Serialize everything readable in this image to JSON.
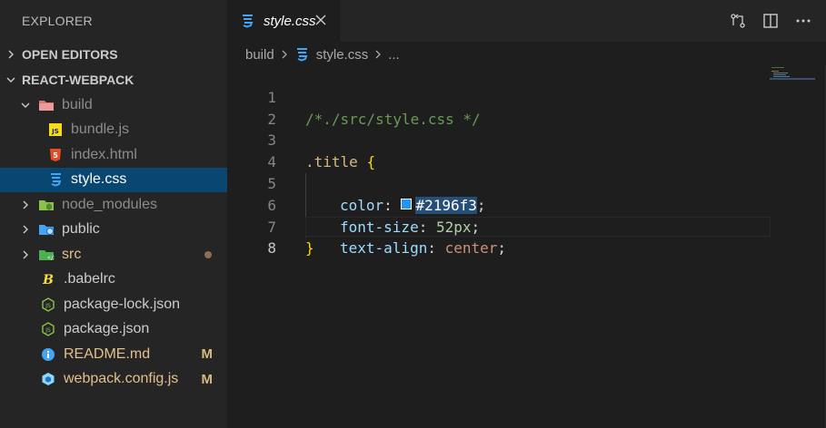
{
  "explorer": {
    "title": "EXPLORER",
    "open_editors": "OPEN EDITORS",
    "project": "REACT-WEBPACK",
    "items": [
      {
        "label": "build",
        "status": ""
      },
      {
        "label": "bundle.js",
        "status": ""
      },
      {
        "label": "index.html",
        "status": ""
      },
      {
        "label": "style.css",
        "status": ""
      },
      {
        "label": "node_modules",
        "status": ""
      },
      {
        "label": "public",
        "status": ""
      },
      {
        "label": "src",
        "status": ""
      },
      {
        "label": ".babelrc",
        "status": ""
      },
      {
        "label": "package-lock.json",
        "status": ""
      },
      {
        "label": "package.json",
        "status": ""
      },
      {
        "label": "README.md",
        "status": "M"
      },
      {
        "label": "webpack.config.js",
        "status": "M"
      }
    ]
  },
  "tab": {
    "label": "style.css"
  },
  "breadcrumb": {
    "folder": "build",
    "file": "style.css",
    "more": "..."
  },
  "code": {
    "line_numbers": [
      "1",
      "2",
      "3",
      "4",
      "5",
      "6",
      "7",
      "8"
    ],
    "comment": "/*./src/style.css */",
    "selector": ".title",
    "open_brace": "{",
    "close_brace": "}",
    "prop_color": "color",
    "val_color": "#2196f3",
    "prop_font_size": "font-size",
    "val_font_size_num": "52px",
    "prop_text_align": "text-align",
    "val_text_align": "center",
    "colon": ":",
    "semicolon": ";"
  },
  "colors": {
    "accent_selected_row": "#094771",
    "swatch": "#2196f3",
    "modified_badge": "#d7ba7d",
    "css_icon": "#42a5f5"
  }
}
